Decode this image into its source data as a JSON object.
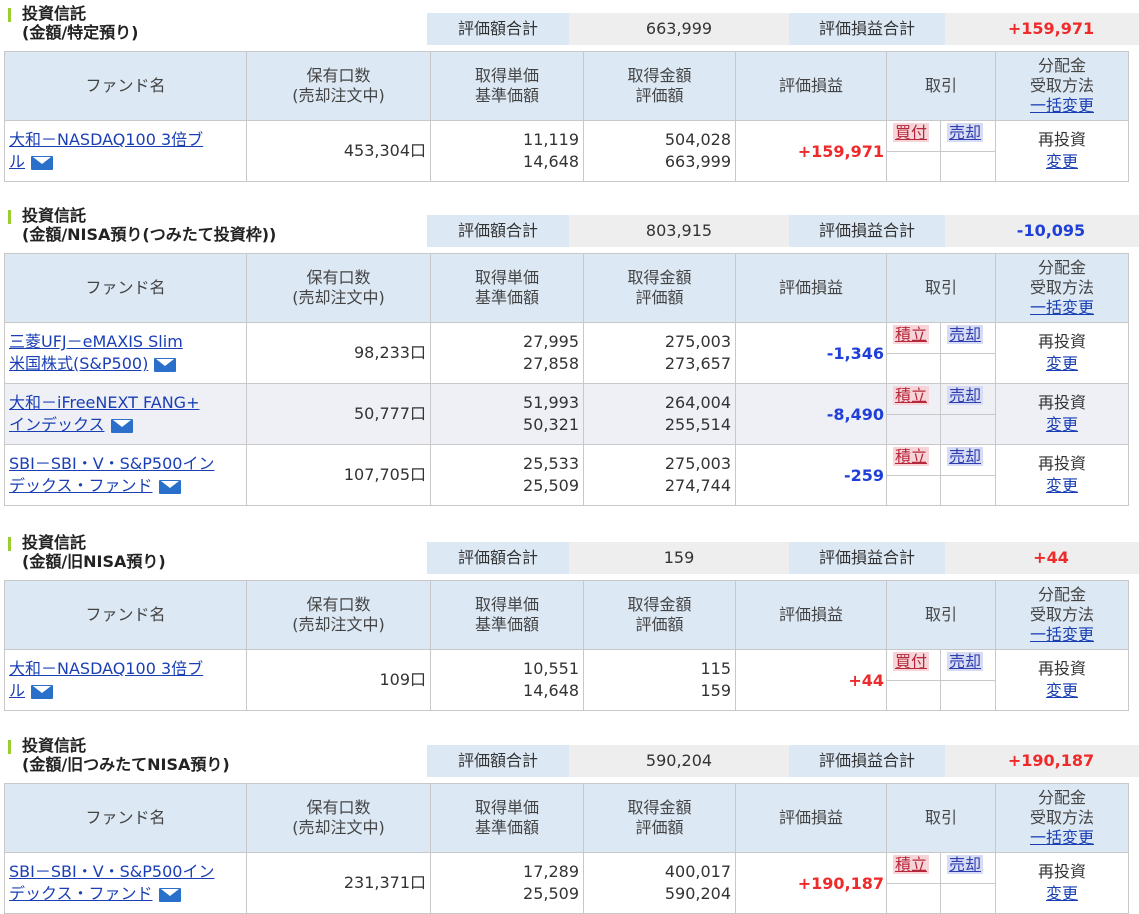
{
  "labels": {
    "total_value": "評価額合計",
    "total_pl": "評価損益合計",
    "col_fund": "ファンド名",
    "col_units_1": "保有口数",
    "col_units_2": "(売却注文中)",
    "col_unit_price_1": "取得単価",
    "col_unit_price_2": "基準価額",
    "col_amount_1": "取得金額",
    "col_amount_2": "評価額",
    "col_pl": "評価損益",
    "col_trade": "取引",
    "col_dist_1": "分配金",
    "col_dist_2": "受取方法",
    "col_dist_3": "一括変更",
    "reinvest": "再投資",
    "change": "変更",
    "sell": "売却"
  },
  "sections": [
    {
      "title1": "投資信託",
      "title2": "(金額/特定預り)",
      "total_value": "663,999",
      "total_pl": "+159,971",
      "funds": [
        {
          "name1": "大和－NASDAQ100 3倍ブ",
          "name2": "ル",
          "units": "453,304口",
          "unit_cost": "11,119",
          "nav": "14,648",
          "cost": "504,028",
          "value": "663,999",
          "pl": "+159,971",
          "trade1": "買付"
        }
      ]
    },
    {
      "title1": "投資信託",
      "title2": "(金額/NISA預り(つみたて投資枠))",
      "total_value": "803,915",
      "total_pl": "-10,095",
      "funds": [
        {
          "name1": "三菱UFJ－eMAXIS Slim",
          "name2": "米国株式(S&P500)",
          "units": "98,233口",
          "unit_cost": "27,995",
          "nav": "27,858",
          "cost": "275,003",
          "value": "273,657",
          "pl": "-1,346",
          "trade1": "積立"
        },
        {
          "name1": "大和－iFreeNEXT FANG+",
          "name2": "インデックス",
          "units": "50,777口",
          "unit_cost": "51,993",
          "nav": "50,321",
          "cost": "264,004",
          "value": "255,514",
          "pl": "-8,490",
          "trade1": "積立"
        },
        {
          "name1": "SBI－SBI・V・S&P500イン",
          "name2": "デックス・ファンド",
          "units": "107,705口",
          "unit_cost": "25,533",
          "nav": "25,509",
          "cost": "275,003",
          "value": "274,744",
          "pl": "-259",
          "trade1": "積立"
        }
      ]
    },
    {
      "title1": "投資信託",
      "title2": "(金額/旧NISA預り)",
      "total_value": "159",
      "total_pl": "+44",
      "funds": [
        {
          "name1": "大和－NASDAQ100 3倍ブ",
          "name2": "ル",
          "units": "109口",
          "unit_cost": "10,551",
          "nav": "14,648",
          "cost": "115",
          "value": "159",
          "pl": "+44",
          "trade1": "買付"
        }
      ]
    },
    {
      "title1": "投資信託",
      "title2": "(金額/旧つみたてNISA預り)",
      "total_value": "590,204",
      "total_pl": "+190,187",
      "funds": [
        {
          "name1": "SBI－SBI・V・S&P500イン",
          "name2": "デックス・ファンド",
          "units": "231,371口",
          "unit_cost": "17,289",
          "nav": "25,509",
          "cost": "400,017",
          "value": "590,204",
          "pl": "+190,187",
          "trade1": "積立"
        }
      ]
    }
  ],
  "colors": {
    "positive": "#ee2a2a",
    "negative": "#1f3fd6",
    "header_bg": "#dce8f4",
    "accent_bar": "#9acd32"
  },
  "icons": {
    "mail": "mail-icon"
  }
}
